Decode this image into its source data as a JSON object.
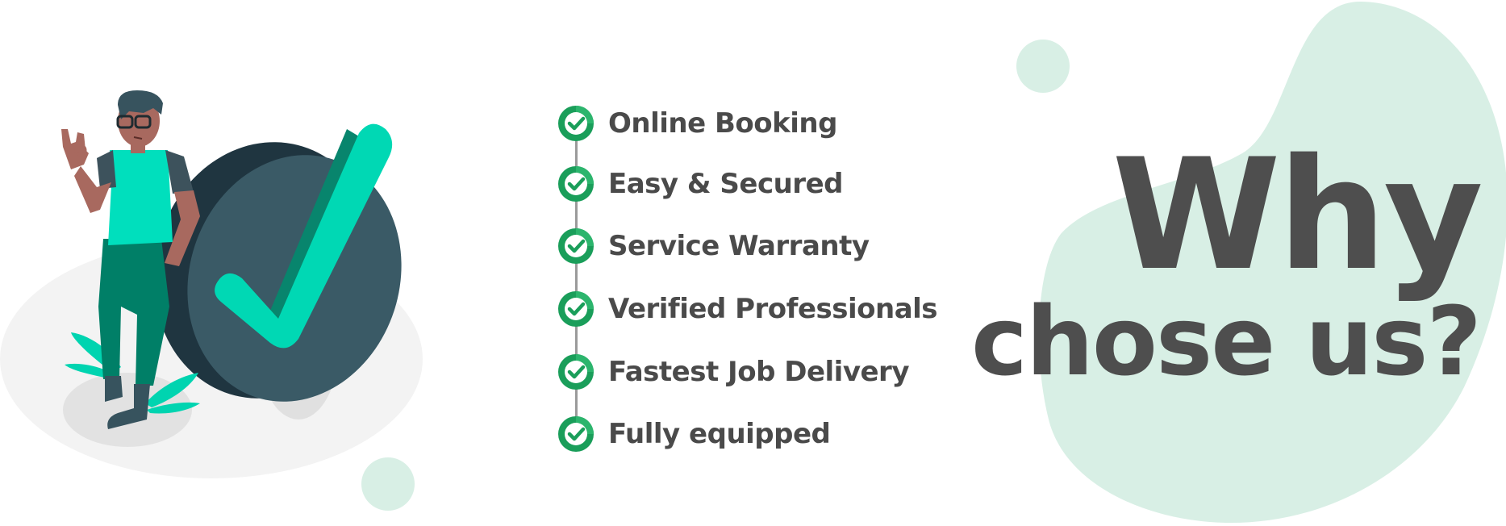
{
  "heading": {
    "line1": "Why",
    "line2": "chose us?"
  },
  "features": [
    {
      "label": "Online Booking",
      "icon": "check-circle-icon"
    },
    {
      "label": "Easy & Secured",
      "icon": "check-circle-icon"
    },
    {
      "label": "Service Warranty",
      "icon": "check-circle-icon"
    },
    {
      "label": "Verified Professionals",
      "icon": "check-circle-icon"
    },
    {
      "label": "Fastest Job Delivery",
      "icon": "check-circle-icon"
    },
    {
      "label": "Fully equipped",
      "icon": "check-circle-icon"
    }
  ],
  "colors": {
    "accent": "#00d4b0",
    "accent_dark": "#06866c",
    "badge_green": "#1a9e5a",
    "text": "#4a4a4a",
    "blob": "#d6efe4",
    "check_bg": "#37535e"
  },
  "illustration": {
    "subject": "person-with-checkmark-illustration"
  }
}
